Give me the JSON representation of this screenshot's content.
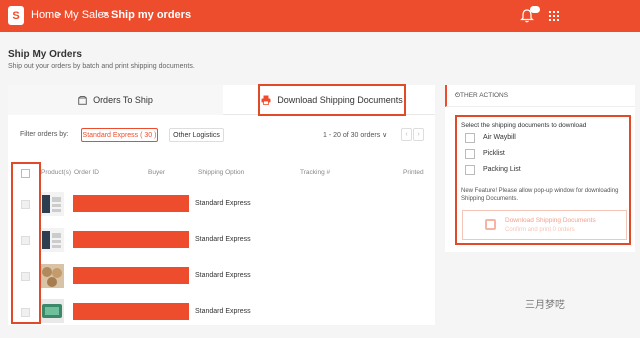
{
  "header": {
    "logo_letter": "S",
    "breadcrumb": {
      "home": "Home",
      "sep1": " >",
      "sales": "My Sales",
      "sep2": " >",
      "current": "Ship my orders"
    },
    "notification_count": "24",
    "bg_color": "#ee4d2d"
  },
  "page": {
    "title": "Ship My Orders",
    "subtitle": "Ship out your orders by batch and print shipping documents."
  },
  "tabs": [
    {
      "label": "Orders To Ship",
      "icon": "box-icon"
    },
    {
      "label": "Download Shipping Documents",
      "icon": "printer-icon"
    }
  ],
  "filter": {
    "label": "Filter orders by:",
    "options": [
      "Standard Express ( 30 )",
      "Other Logistics"
    ],
    "selected": "Standard Express ( 30 )"
  },
  "pagination": {
    "text": "1 - 20 of 30 orders",
    "dropdown": "∨",
    "prev": "‹",
    "next": "›"
  },
  "table": {
    "columns": [
      "Product(s)",
      "Order ID",
      "Buyer",
      "Shipping Option",
      "Tracking #",
      "Printed"
    ],
    "rows": [
      {
        "shipping_option": "Standard Express"
      },
      {
        "shipping_option": "Standard Express"
      },
      {
        "shipping_option": "Standard Express"
      },
      {
        "shipping_option": "Standard Express"
      }
    ]
  },
  "side": {
    "header": "OTHER ACTIONS",
    "chevron": "^",
    "description": "Select the shipping documents to download",
    "options": [
      "Air Waybill",
      "Picklist",
      "Packing List"
    ],
    "note": "New Feature! Please allow pop-up window for downloading Shipping Documents.",
    "button_label": "Download Shipping Documents",
    "button_sub": "Confirm and print 0 orders"
  },
  "watermark": "三月梦呓",
  "colors": {
    "accent": "#ee4d2d",
    "highlight_box": "#e04a28"
  }
}
